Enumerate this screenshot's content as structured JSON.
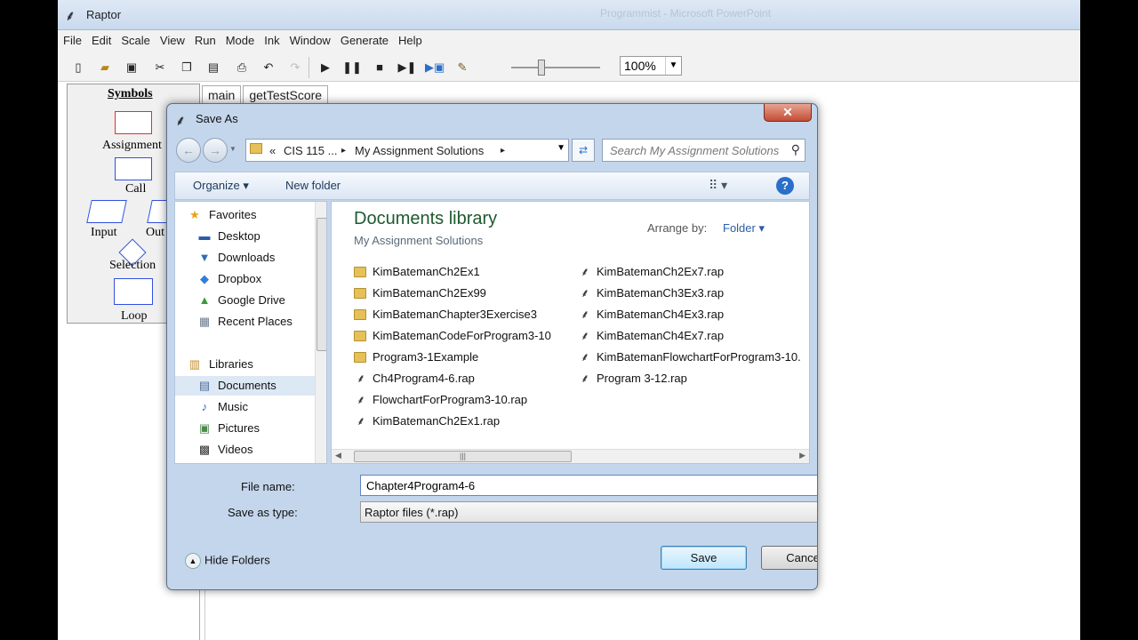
{
  "app": {
    "title": "Raptor",
    "background_window_title": "Programmist - Microsoft PowerPoint",
    "menu": [
      "File",
      "Edit",
      "Scale",
      "View",
      "Run",
      "Mode",
      "Ink",
      "Window",
      "Generate",
      "Help"
    ],
    "zoom": "100%",
    "symbols": {
      "header": "Symbols",
      "items": [
        "Assignment",
        "Call",
        "Input",
        "Out",
        "Selection",
        "Loop"
      ]
    },
    "tabs": [
      "main",
      "getTestScore"
    ]
  },
  "dialog": {
    "title": "Save As",
    "close_glyph": "✕",
    "address": {
      "prefix": "«",
      "crumb1": "CIS 115 ...",
      "sep": "▸",
      "crumb2": "My Assignment Solutions",
      "sep2": "▸"
    },
    "search_placeholder": "Search My Assignment Solutions",
    "commands": {
      "organize": "Organize ▾",
      "new_folder": "New folder"
    },
    "nav": [
      {
        "label": "Favorites",
        "icon": "star-icon",
        "glyph": "★",
        "color": "#e8a317"
      },
      {
        "label": "Desktop",
        "icon": "desktop-icon",
        "glyph": "▬",
        "color": "#2b5aa8"
      },
      {
        "label": "Downloads",
        "icon": "downloads-icon",
        "glyph": "▼",
        "color": "#2b6cb8"
      },
      {
        "label": "Dropbox",
        "icon": "dropbox-icon",
        "glyph": "◆",
        "color": "#2f7fd7"
      },
      {
        "label": "Google Drive",
        "icon": "google-drive-icon",
        "glyph": "▲",
        "color": "#3a9a3a"
      },
      {
        "label": "Recent Places",
        "icon": "recent-places-icon",
        "glyph": "▦",
        "color": "#6b7c90"
      },
      {
        "label": "Libraries",
        "icon": "libraries-icon",
        "glyph": "▥",
        "color": "#c48a2a"
      },
      {
        "label": "Documents",
        "icon": "documents-icon",
        "glyph": "▤",
        "color": "#4a6a9a",
        "selected": true
      },
      {
        "label": "Music",
        "icon": "music-icon",
        "glyph": "♪",
        "color": "#2b6cb8"
      },
      {
        "label": "Pictures",
        "icon": "pictures-icon",
        "glyph": "▣",
        "color": "#4a8a4a"
      },
      {
        "label": "Videos",
        "icon": "videos-icon",
        "glyph": "▩",
        "color": "#333333"
      }
    ],
    "library_title": "Documents library",
    "library_subtitle": "My Assignment Solutions",
    "arrange_label": "Arrange by:",
    "arrange_value": "Folder ▾",
    "files_col1": [
      {
        "name": "KimBatemanCh2Ex1",
        "type": "folder"
      },
      {
        "name": "KimBatemanCh2Ex99",
        "type": "folder"
      },
      {
        "name": "KimBatemanChapter3Exercise3",
        "type": "folder"
      },
      {
        "name": "KimBatemanCodeForProgram3-10",
        "type": "folder"
      },
      {
        "name": "Program3-1Example",
        "type": "folder"
      },
      {
        "name": "Ch4Program4-6.rap",
        "type": "rap"
      },
      {
        "name": "FlowchartForProgram3-10.rap",
        "type": "rap"
      },
      {
        "name": "KimBatemanCh2Ex1.rap",
        "type": "rap"
      }
    ],
    "files_col2": [
      {
        "name": "KimBatemanCh2Ex7.rap",
        "type": "rap"
      },
      {
        "name": "KimBatemanCh3Ex3.rap",
        "type": "rap"
      },
      {
        "name": "KimBatemanCh4Ex3.rap",
        "type": "rap"
      },
      {
        "name": "KimBatemanCh4Ex7.rap",
        "type": "rap"
      },
      {
        "name": "KimBatemanFlowchartForProgram3-10.",
        "type": "rap"
      },
      {
        "name": "Program 3-12.rap",
        "type": "rap"
      }
    ],
    "file_name_label": "File name:",
    "file_name_value": "Chapter4Program4-6",
    "save_type_label": "Save as type:",
    "save_type_value": "Raptor files (*.rap)",
    "hide_folders": "Hide Folders",
    "save_button": "Save",
    "cancel_button": "Cancel"
  }
}
